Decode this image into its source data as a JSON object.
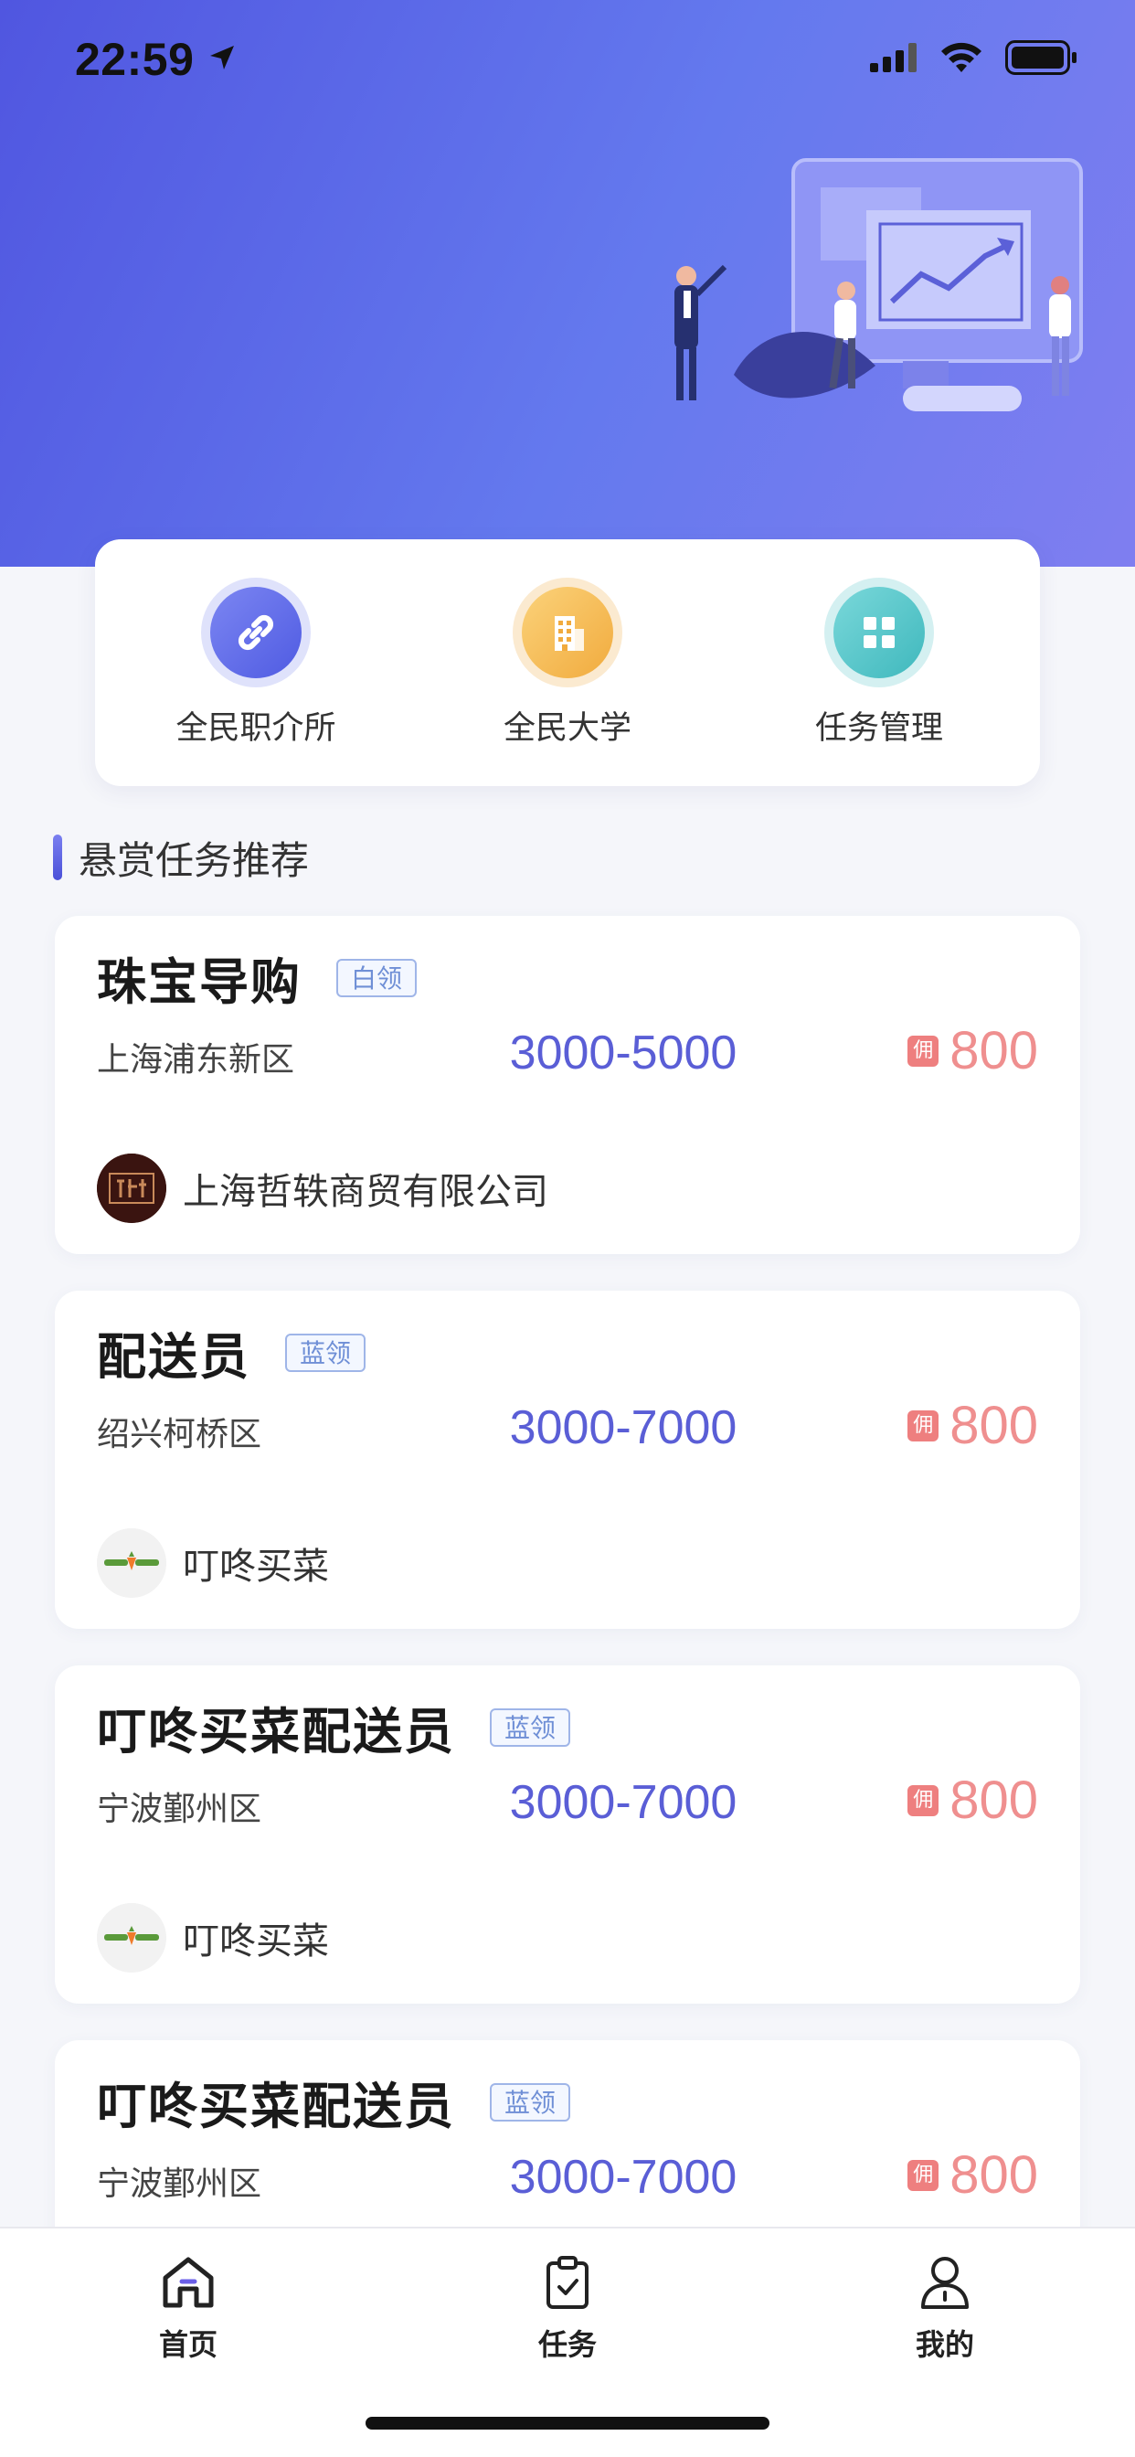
{
  "status": {
    "time": "22:59"
  },
  "quick_menu": [
    {
      "label": "全民职介所",
      "icon": "link-icon",
      "color": "#5a66e8"
    },
    {
      "label": "全民大学",
      "icon": "building-icon",
      "color": "#f4b84a"
    },
    {
      "label": "任务管理",
      "icon": "grid-icon",
      "color": "#3fb8bd"
    }
  ],
  "section": {
    "title": "悬赏任务推荐"
  },
  "tasks": [
    {
      "title": "珠宝导购",
      "tag": "白领",
      "location": "上海浦东新区",
      "salary": "3000-5000",
      "reward_badge": "佣",
      "reward": "800",
      "company": "上海哲轶商贸有限公司"
    },
    {
      "title": "配送员",
      "tag": "蓝领",
      "location": "绍兴柯桥区",
      "salary": "3000-7000",
      "reward_badge": "佣",
      "reward": "800",
      "company": "叮咚买菜"
    },
    {
      "title": "叮咚买菜配送员",
      "tag": "蓝领",
      "location": "宁波鄞州区",
      "salary": "3000-7000",
      "reward_badge": "佣",
      "reward": "800",
      "company": "叮咚买菜"
    },
    {
      "title": "叮咚买菜配送员",
      "tag": "蓝领",
      "location": "宁波鄞州区",
      "salary": "3000-7000",
      "reward_badge": "佣",
      "reward": "800",
      "company": ""
    }
  ],
  "tabs": [
    {
      "label": "首页",
      "icon": "home-icon"
    },
    {
      "label": "任务",
      "icon": "clipboard-icon"
    },
    {
      "label": "我的",
      "icon": "user-icon"
    }
  ],
  "colors": {
    "accent": "#5a5ed6",
    "reward": "#ef8f8f",
    "hero_start": "#5056e0",
    "hero_end": "#7f7ef0"
  }
}
